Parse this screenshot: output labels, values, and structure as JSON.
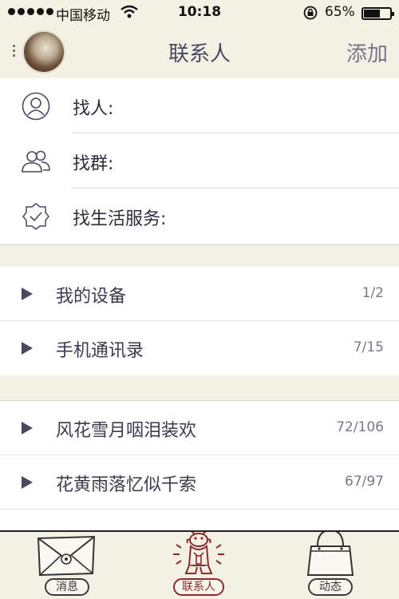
{
  "status_bar": {
    "carrier": "中国移动",
    "time": "10:18",
    "battery_percent": "65%"
  },
  "nav": {
    "title": "联系人",
    "add_label": "添加"
  },
  "find": [
    {
      "label": "找人:",
      "icon": "person-icon"
    },
    {
      "label": "找群:",
      "icon": "group-icon"
    },
    {
      "label": "找生活服务:",
      "icon": "service-badge-icon"
    }
  ],
  "groups_a": [
    {
      "name": "我的设备",
      "count": "1/2"
    },
    {
      "name": "手机通讯录",
      "count": "7/15"
    }
  ],
  "groups_b": [
    {
      "name": "风花雪月咽泪装欢",
      "count": "72/106"
    },
    {
      "name": "花黄雨落忆似千索",
      "count": "67/97"
    }
  ],
  "tabs": [
    {
      "label": "消息",
      "icon": "envelope-icon",
      "active": false
    },
    {
      "label": "联系人",
      "icon": "monkey-icon",
      "active": true
    },
    {
      "label": "动态",
      "icon": "bag-icon",
      "active": false
    }
  ],
  "colors": {
    "background": "#f3f1e4",
    "accent_active": "#8a2a2a",
    "text_primary": "#3c3a4c"
  }
}
